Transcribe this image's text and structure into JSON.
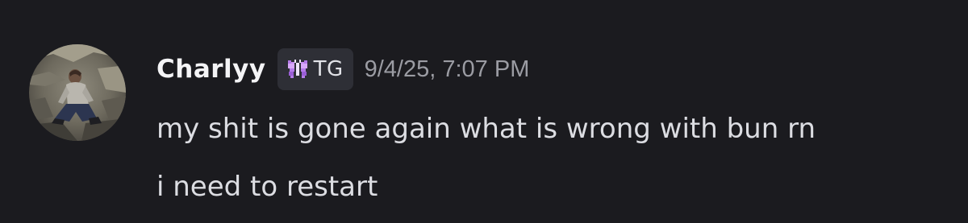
{
  "message": {
    "author": {
      "username": "Charlyy",
      "username_color": "#f4f4f6",
      "avatar_icon": "user-photo-avatar"
    },
    "tag": {
      "icon": "butterfly-icon",
      "icon_color": "#c08cf0",
      "text": "TG"
    },
    "timestamp": "9/4/25, 7:07 PM",
    "lines": [
      "my shit is gone again what is wrong with bun rn",
      "i need to restart"
    ]
  },
  "colors": {
    "background": "#1b1b1f",
    "tag_background": "#2e2f36",
    "text": "#dcdde2",
    "muted": "#9b9ca3"
  }
}
